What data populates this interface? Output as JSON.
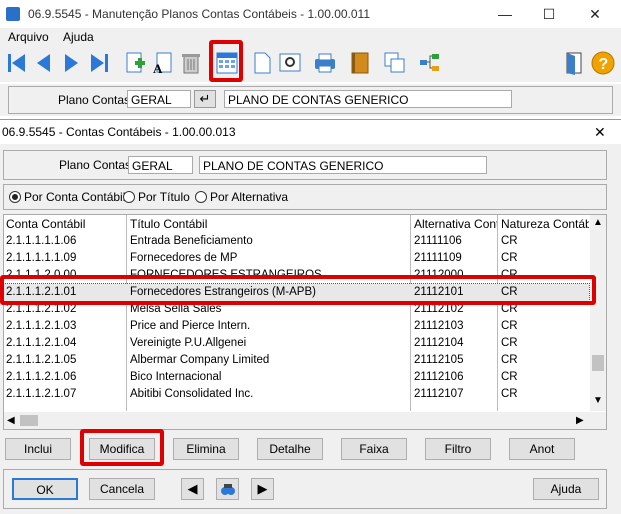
{
  "main_window": {
    "title": "06.9.5545 - Manutenção Planos Contas Contábeis - 1.00.00.011",
    "menu": [
      "Arquivo",
      "Ajuda"
    ],
    "plano_label": "Plano Contas:",
    "plano_code": "GERAL",
    "plano_desc": "PLANO DE CONTAS GENERICO"
  },
  "dialog": {
    "title": "06.9.5545 - Contas Contábeis - 1.00.00.013",
    "plano_label": "Plano Contas:",
    "plano_code": "GERAL",
    "plano_desc": "PLANO DE CONTAS GENERICO",
    "radio_options": [
      {
        "label": "Por Conta Contábil",
        "selected": true
      },
      {
        "label": "Por Título",
        "selected": false
      },
      {
        "label": "Por Alternativa",
        "selected": false
      }
    ],
    "columns": [
      "Conta Contábil",
      "Título Contábil",
      "Alternativa Conta",
      "Natureza Contábil"
    ],
    "rows": [
      [
        "2.1.1.1.1.1.06",
        "Entrada Beneficiamento",
        "21111106",
        "CR"
      ],
      [
        "2.1.1.1.1.1.09",
        "Fornecedores de MP",
        "21111109",
        "CR"
      ],
      [
        "2.1.1.1.2.0.00",
        "FORNECEDORES ESTRANGEIROS",
        "21112000",
        "CR"
      ],
      [
        "2.1.1.1.2.1.01",
        "Fornecedores Estrangeiros (M-APB)",
        "21112101",
        "CR"
      ],
      [
        "2.1.1.1.2.1.02",
        "Melsa Sella Sales",
        "21112102",
        "CR"
      ],
      [
        "2.1.1.1.2.1.03",
        "Price and Pierce Intern.",
        "21112103",
        "CR"
      ],
      [
        "2.1.1.1.2.1.04",
        "Vereinigte P.U.Allgenei",
        "21112104",
        "CR"
      ],
      [
        "2.1.1.1.2.1.05",
        "Albermar Company Limited",
        "21112105",
        "CR"
      ],
      [
        "2.1.1.1.2.1.06",
        "Bico Internacional",
        "21112106",
        "CR"
      ],
      [
        "2.1.1.1.2.1.07",
        "Abitibi Consolidated Inc.",
        "21112107",
        "CR"
      ]
    ],
    "selected_row": 3,
    "action_buttons": [
      "Inclui",
      "Modifica",
      "Elimina",
      "Detalhe",
      "Faixa",
      "Filtro",
      "Anot"
    ],
    "ok": "OK",
    "cancel": "Cancela",
    "help": "Ajuda"
  },
  "colors": {
    "highlight": "#dd0000",
    "selected_row_bg": "#e8e8e8"
  }
}
